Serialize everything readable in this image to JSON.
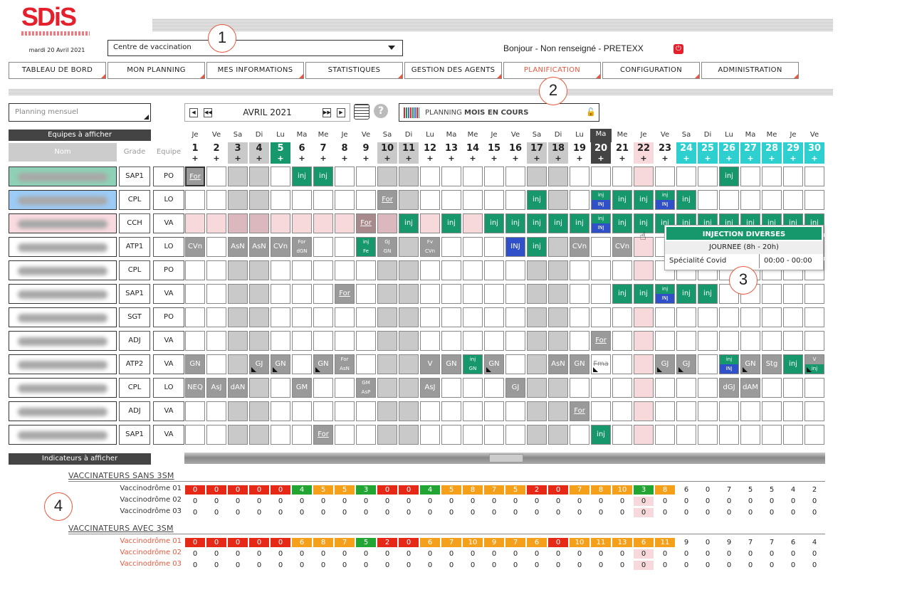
{
  "header": {
    "logo_text": "SDiS",
    "date": "mardi 20 Avril 2021",
    "centre_value": "Centre de vaccination",
    "greeting": "Bonjour - Non renseigné - PRETEXX",
    "power_icon": "power-icon"
  },
  "nav": {
    "tabs": [
      {
        "label": "TABLEAU DE BORD",
        "active": false
      },
      {
        "label": "MON PLANNING",
        "active": false
      },
      {
        "label": "MES INFORMATIONS",
        "active": false
      },
      {
        "label": "STATISTIQUES",
        "active": false
      },
      {
        "label": "GESTION DES AGENTS",
        "active": false
      },
      {
        "label": "PLANIFICATION",
        "active": true
      },
      {
        "label": "CONFIGURATION",
        "active": false
      },
      {
        "label": "ADMINISTRATION",
        "active": false
      }
    ]
  },
  "callouts": [
    "1",
    "2",
    "3",
    "4"
  ],
  "toolbar": {
    "planning_mode": "Planning mensuel",
    "month": "AVRIL 2021",
    "plan_prefix": "PLANNING",
    "plan_bold": "MOIS EN COURS",
    "lock_icon": "lock-open-icon",
    "calendar_icon": "calendar-icon",
    "help_icon": "help-icon",
    "help_glyph": "?",
    "prev_month_btn": "◀",
    "prev_year_btn": "◀◀",
    "next_year_btn": "▶▶",
    "next_month_btn": "▶"
  },
  "table_headers": {
    "teams": "Equipes à afficher",
    "nom": "Nom",
    "grade": "Grade",
    "equipe": "Equipe"
  },
  "days": [
    {
      "dow": "Je",
      "n": "1",
      "kind": "n"
    },
    {
      "dow": "Ve",
      "n": "2",
      "kind": "n"
    },
    {
      "dow": "Sa",
      "n": "3",
      "kind": "we"
    },
    {
      "dow": "Di",
      "n": "4",
      "kind": "we"
    },
    {
      "dow": "Lu",
      "n": "5",
      "kind": "g"
    },
    {
      "dow": "Ma",
      "n": "6",
      "kind": "n"
    },
    {
      "dow": "Me",
      "n": "7",
      "kind": "n"
    },
    {
      "dow": "Je",
      "n": "8",
      "kind": "n"
    },
    {
      "dow": "Ve",
      "n": "9",
      "kind": "n"
    },
    {
      "dow": "Sa",
      "n": "10",
      "kind": "we"
    },
    {
      "dow": "Di",
      "n": "11",
      "kind": "we"
    },
    {
      "dow": "Lu",
      "n": "12",
      "kind": "n"
    },
    {
      "dow": "Ma",
      "n": "13",
      "kind": "n"
    },
    {
      "dow": "Me",
      "n": "14",
      "kind": "n"
    },
    {
      "dow": "Je",
      "n": "15",
      "kind": "n"
    },
    {
      "dow": "Ve",
      "n": "16",
      "kind": "n"
    },
    {
      "dow": "Sa",
      "n": "17",
      "kind": "we"
    },
    {
      "dow": "Di",
      "n": "18",
      "kind": "we"
    },
    {
      "dow": "Lu",
      "n": "19",
      "kind": "n"
    },
    {
      "dow": "Ma",
      "n": "20",
      "kind": "today"
    },
    {
      "dow": "Me",
      "n": "21",
      "kind": "n"
    },
    {
      "dow": "Je",
      "n": "22",
      "kind": "pink"
    },
    {
      "dow": "Ve",
      "n": "23",
      "kind": "n"
    },
    {
      "dow": "Sa",
      "n": "24",
      "kind": "t"
    },
    {
      "dow": "Di",
      "n": "25",
      "kind": "t"
    },
    {
      "dow": "Lu",
      "n": "26",
      "kind": "t"
    },
    {
      "dow": "Ma",
      "n": "27",
      "kind": "t"
    },
    {
      "dow": "Me",
      "n": "28",
      "kind": "t"
    },
    {
      "dow": "Je",
      "n": "29",
      "kind": "t"
    },
    {
      "dow": "Ve",
      "n": "30",
      "kind": "t"
    }
  ],
  "day_plus": "+",
  "colors": {
    "green": "#17986c",
    "grey": "#9a9a9a",
    "blue": "#2f50c9",
    "pink": "#f7d9dc",
    "teal": "#2dcfcf",
    "weekend": "#c9c9c9",
    "red": "#e62817",
    "orange": "#f5a01b",
    "bright_green": "#22a533"
  },
  "rows": [
    {
      "name_color": "#8fd1b6",
      "grade": "SAP1",
      "equipe": "PO",
      "cells": {
        "1": "For*",
        "6": "inj",
        "7": "inj",
        "26": "inj"
      }
    },
    {
      "name_color": "#9ccbf5",
      "grade": "CPL",
      "equipe": "LO",
      "cells": {
        "10": "For",
        "17": "inj",
        "20": "inj|INJ",
        "21": "inj",
        "22": "inj",
        "23": "inj|INJ",
        "24": "inj"
      }
    },
    {
      "name_color": "#f9dbe0",
      "grade": "CCH",
      "equipe": "VA",
      "pinkrow": true,
      "cells": {
        "9": "For~",
        "11": "inj",
        "13": "inj",
        "15": "inj",
        "16": "inj",
        "17": "inj",
        "18": "inj",
        "19": "inj",
        "20": "inj|INJ",
        "21": "inj",
        "22": "inj",
        "23": "inj",
        "24": "inj",
        "25": "inj",
        "26": "inj",
        "27": "inj",
        "28": "inj",
        "29": "inj",
        "30": "inj"
      }
    },
    {
      "grade": "ATP1",
      "equipe": "LO",
      "cells": {
        "1": "CVn",
        "3": "AsN",
        "4": "AsN",
        "5": "CVn",
        "6": "For|dGN",
        "9": "inj|Fe",
        "10": "GJ|GN",
        "12": "Fv|CVn",
        "16": "INJ",
        "17": "inj",
        "19": "CVn",
        "21": "CVn"
      }
    },
    {
      "grade": "CPL",
      "equipe": "PO",
      "cells": {}
    },
    {
      "grade": "SAP1",
      "equipe": "VA",
      "cells": {
        "8": "For",
        "21": "inj",
        "22": "inj",
        "23": "inj|INJ",
        "24": "inj",
        "25": "inj"
      }
    },
    {
      "grade": "SGT",
      "equipe": "PO",
      "cells": {}
    },
    {
      "grade": "ADJ",
      "equipe": "VA",
      "cells": {
        "20": "For"
      }
    },
    {
      "grade": "ATP2",
      "equipe": "VA",
      "cells": {
        "1": "GN",
        "4": "GJ",
        "5": "GN",
        "7": "GN",
        "8": "For|AsN",
        "12": "V",
        "13": "GN",
        "14": "inj|GN",
        "15": "GN",
        "18": "AsN",
        "19": "GN",
        "20": "Fma",
        "23": "GJ",
        "24": "GJ",
        "26": "inj|INJ",
        "27": "GN",
        "28": "Stg",
        "29": "inj",
        "30": "V|inj"
      }
    },
    {
      "grade": "CPL",
      "equipe": "LO",
      "cells": {
        "1": "NEQ",
        "2": "AsJ",
        "3": "dAN",
        "6": "GM",
        "9": "GM|AsP",
        "12": "AsJ",
        "16": "GJ",
        "26": "dGJ",
        "27": "dAM"
      }
    },
    {
      "grade": "ADJ",
      "equipe": "VA",
      "cells": {
        "19": "For"
      }
    },
    {
      "grade": "SAP1",
      "equipe": "VA",
      "cells": {
        "7": "For",
        "20": "inj"
      }
    }
  ],
  "tooltip": {
    "title": "INJECTION DIVERSES",
    "subtitle": "JOURNEE (8h - 20h)",
    "label": "Spécialité Covid",
    "time": "00:00 - 00:00",
    "cursor_icon": "hand-cursor-icon"
  },
  "indicators": {
    "title": "Indicateurs à afficher",
    "sections": [
      {
        "title": "VACCINATEURS SANS 3SM",
        "rows": [
          {
            "label": "Vaccinodrôme 01",
            "red": false,
            "values": [
              0,
              0,
              0,
              0,
              0,
              4,
              5,
              5,
              3,
              0,
              0,
              4,
              5,
              8,
              7,
              5,
              2,
              0,
              7,
              8,
              10,
              3,
              8,
              6,
              0,
              7,
              5,
              5,
              4,
              2
            ]
          },
          {
            "label": "Vaccinodrôme 02",
            "red": false,
            "values": [
              0,
              0,
              0,
              0,
              0,
              0,
              0,
              0,
              0,
              0,
              0,
              0,
              0,
              0,
              0,
              0,
              0,
              0,
              0,
              0,
              0,
              0,
              0,
              0,
              0,
              0,
              0,
              0,
              0,
              0
            ]
          },
          {
            "label": "Vaccinodrôme 03",
            "red": false,
            "values": [
              0,
              0,
              0,
              0,
              0,
              0,
              0,
              0,
              0,
              0,
              0,
              0,
              0,
              0,
              0,
              0,
              0,
              0,
              0,
              0,
              0,
              0,
              0,
              0,
              0,
              0,
              0,
              0,
              0,
              0
            ]
          }
        ]
      },
      {
        "title": "VACCINATEURS AVEC 3SM",
        "rows": [
          {
            "label": "Vaccinodrôme 01",
            "red": true,
            "values": [
              0,
              0,
              0,
              0,
              0,
              6,
              8,
              7,
              5,
              2,
              0,
              6,
              7,
              10,
              9,
              7,
              6,
              0,
              10,
              11,
              13,
              6,
              11,
              9,
              0,
              9,
              7,
              7,
              6,
              4
            ]
          },
          {
            "label": "Vaccinodrôme 02",
            "red": true,
            "values": [
              0,
              0,
              0,
              0,
              0,
              0,
              0,
              0,
              0,
              0,
              0,
              0,
              0,
              0,
              0,
              0,
              0,
              0,
              0,
              0,
              0,
              0,
              0,
              0,
              0,
              0,
              0,
              0,
              0,
              0
            ]
          },
          {
            "label": "Vaccinodrôme 03",
            "red": true,
            "values": [
              0,
              0,
              0,
              0,
              0,
              0,
              0,
              0,
              0,
              0,
              0,
              0,
              0,
              0,
              0,
              0,
              0,
              0,
              0,
              0,
              0,
              0,
              0,
              0,
              0,
              0,
              0,
              0,
              0,
              0
            ]
          }
        ]
      }
    ]
  }
}
